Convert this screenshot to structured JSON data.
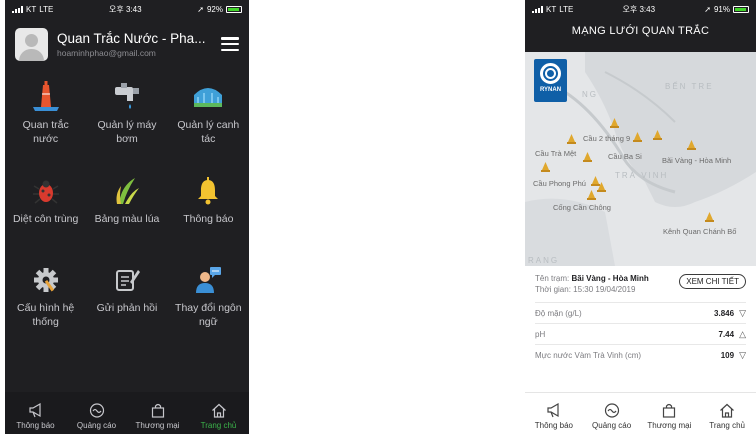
{
  "status_left": {
    "carrier": "KT",
    "network": "LTE"
  },
  "phone1": {
    "status": {
      "time": "오후 3:43",
      "battery": "92%",
      "battery_level": 0.92
    },
    "user": {
      "name": "Quan Trắc Nước - Pha...",
      "email": "hoaminhphao@gmail.com"
    },
    "menu": [
      {
        "icon": "water-tower-icon",
        "label": "Quan trắc nước"
      },
      {
        "icon": "water-tap-icon",
        "label": "Quản lý máy bơm"
      },
      {
        "icon": "greenhouse-icon",
        "label": "Quản lý canh tác"
      },
      {
        "icon": "bug-icon",
        "label": "Diệt côn trùng"
      },
      {
        "icon": "rice-leaf-icon",
        "label": "Bảng màu lúa"
      },
      {
        "icon": "bell-icon",
        "label": "Thông báo"
      },
      {
        "icon": "gear-icon",
        "label": "Cấu hình hệ thống"
      },
      {
        "icon": "feedback-icon",
        "label": "Gửi phản hồi"
      },
      {
        "icon": "language-person-icon",
        "label": "Thay đổi ngôn ngữ"
      }
    ]
  },
  "phone2": {
    "status": {
      "time": "오후 3:43",
      "battery": "91%",
      "battery_level": 0.91
    },
    "title": "MẠNG LƯỚI QUAN TRẮC",
    "logo": "RYNAN",
    "map_regions": [
      "NG",
      "BẾN TRE",
      "TRÀ VINH",
      "RANG"
    ],
    "stations": [
      "Cầu 2 tháng 9",
      "Cầu Trà Mệt",
      "Cầu Ba Si",
      "Bãi Vàng - Hòa Minh",
      "Cầu Phong Phú",
      "Cống Cần Chông",
      "Kênh Quan Chánh Bố"
    ],
    "info": {
      "station_label": "Tên trạm:",
      "station_name": "Bãi Vàng - Hòa Minh",
      "time_label": "Thời gian:",
      "time_value": "15:30 19/04/2019",
      "detail_button": "XEM CHI TIẾT",
      "metrics": [
        {
          "label": "Độ mặn (g/L)",
          "value": "3.846",
          "trend": "▽"
        },
        {
          "label": "pH",
          "value": "7.44",
          "trend": "△"
        },
        {
          "label": "Mực nước Vàm Trà Vinh (cm)",
          "value": "109",
          "trend": "▽"
        }
      ]
    }
  },
  "tabs": [
    {
      "icon": "megaphone-icon",
      "label": "Thông báo"
    },
    {
      "icon": "advertising-icon",
      "label": "Quảng cáo"
    },
    {
      "icon": "shopping-bag-icon",
      "label": "Thương mại"
    },
    {
      "icon": "home-icon",
      "label": "Trang chủ"
    }
  ],
  "colors": {
    "active_tab": "#3bb34a",
    "dark_bg": "#1f1f22",
    "pin": "#e0a82e",
    "logo": "#0f5fa7"
  }
}
